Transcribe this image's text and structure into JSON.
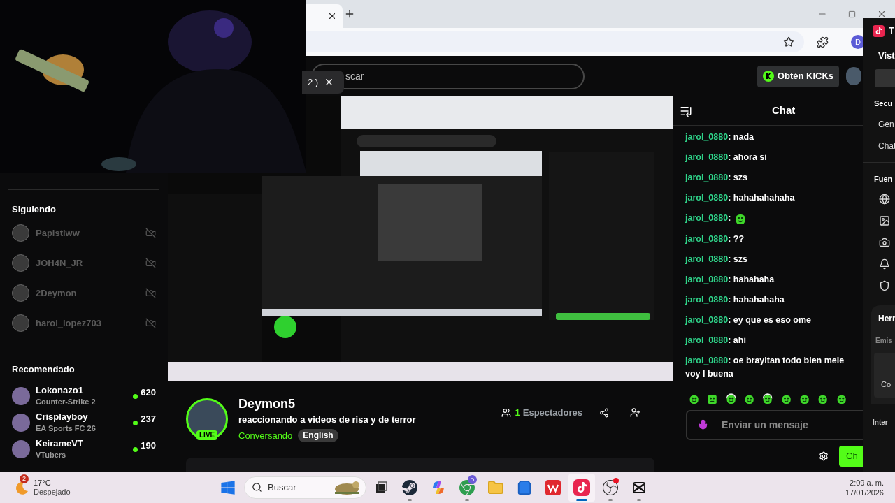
{
  "webcam": {
    "kind": "picture"
  },
  "browser": {
    "profile_initial": "D"
  },
  "overlay_chip": {
    "text": "2 )"
  },
  "header": {
    "search": {
      "placeholder": "scar"
    },
    "kicks_button": "Obtén KICKs"
  },
  "sidebar": {
    "following": {
      "title": "Siguiendo",
      "items": [
        {
          "name": "Papistiww",
          "live": false
        },
        {
          "name": "JOH4N_JR",
          "live": false
        },
        {
          "name": "2Deymon",
          "live": false
        },
        {
          "name": "harol_lopez703",
          "live": false
        }
      ]
    },
    "recommended": {
      "title": "Recomendado",
      "items": [
        {
          "name": "Lokonazo1",
          "category": "Counter-Strike 2",
          "viewers": "620"
        },
        {
          "name": "Crisplayboy",
          "category": "EA Sports FC 26",
          "viewers": "237"
        },
        {
          "name": "KeirameVT",
          "category": "VTubers",
          "viewers": "190"
        }
      ]
    }
  },
  "stream": {
    "video": {
      "kind": "picture"
    },
    "live_badge": "LIVE",
    "channel": "Deymon5",
    "title": "reaccionando a videos de risa y de terror",
    "category": "Conversando",
    "tags": [
      "English"
    ],
    "viewer_count": "1",
    "viewer_label": "Espectadores"
  },
  "chat": {
    "title": "Chat",
    "messages": [
      {
        "user": "jarol_0880",
        "kind": "text",
        "text": "nada"
      },
      {
        "user": "jarol_0880",
        "kind": "text",
        "text": "ahora si"
      },
      {
        "user": "jarol_0880",
        "kind": "text",
        "text": "szs"
      },
      {
        "user": "jarol_0880",
        "kind": "text",
        "text": "hahahahahaha"
      },
      {
        "user": "jarol_0880",
        "kind": "emote"
      },
      {
        "user": "jarol_0880",
        "kind": "text",
        "text": "??"
      },
      {
        "user": "jarol_0880",
        "kind": "text",
        "text": "szs"
      },
      {
        "user": "jarol_0880",
        "kind": "text",
        "text": "hahahaha"
      },
      {
        "user": "jarol_0880",
        "kind": "text",
        "text": "hahahahaha"
      },
      {
        "user": "jarol_0880",
        "kind": "text",
        "text": "ey que es eso ome"
      },
      {
        "user": "jarol_0880",
        "kind": "text",
        "text": "ahi"
      },
      {
        "user": "jarol_0880",
        "kind": "text",
        "text": "oe brayitan todo bien mele voy l buena"
      }
    ],
    "separator": ":",
    "input": {
      "placeholder": "Enviar un mensaje"
    },
    "send_button": "Ch"
  },
  "side_panel": {
    "title": "T",
    "view_label": "Vist",
    "scenes_title": "Secu",
    "scenes": [
      "Gen",
      "Chat"
    ],
    "sources_title": "Fuen",
    "tools_title": "Herr",
    "tools_label": "Emis",
    "tool_item": "Co",
    "interaction": "Inter"
  },
  "taskbar": {
    "weather": {
      "badge": "2",
      "temp": "17°C",
      "condition": "Despejado"
    },
    "search": {
      "placeholder": "Buscar"
    },
    "apps": [
      {
        "kind": "task-view",
        "running": false,
        "active": false
      },
      {
        "kind": "steam",
        "running": true,
        "active": false
      },
      {
        "kind": "copilot",
        "running": false,
        "active": false
      },
      {
        "kind": "chrome",
        "running": true,
        "active": false,
        "badge": "D"
      },
      {
        "kind": "files",
        "running": false,
        "active": false
      },
      {
        "kind": "store",
        "running": false,
        "active": false
      },
      {
        "kind": "wps",
        "running": false,
        "active": false
      },
      {
        "kind": "tiktok",
        "running": true,
        "active": true
      },
      {
        "kind": "obs",
        "running": true,
        "active": false,
        "alert": true
      },
      {
        "kind": "capcut",
        "running": true,
        "active": false
      }
    ],
    "time": "2:09 a. m.",
    "date": "17/01/2026"
  }
}
